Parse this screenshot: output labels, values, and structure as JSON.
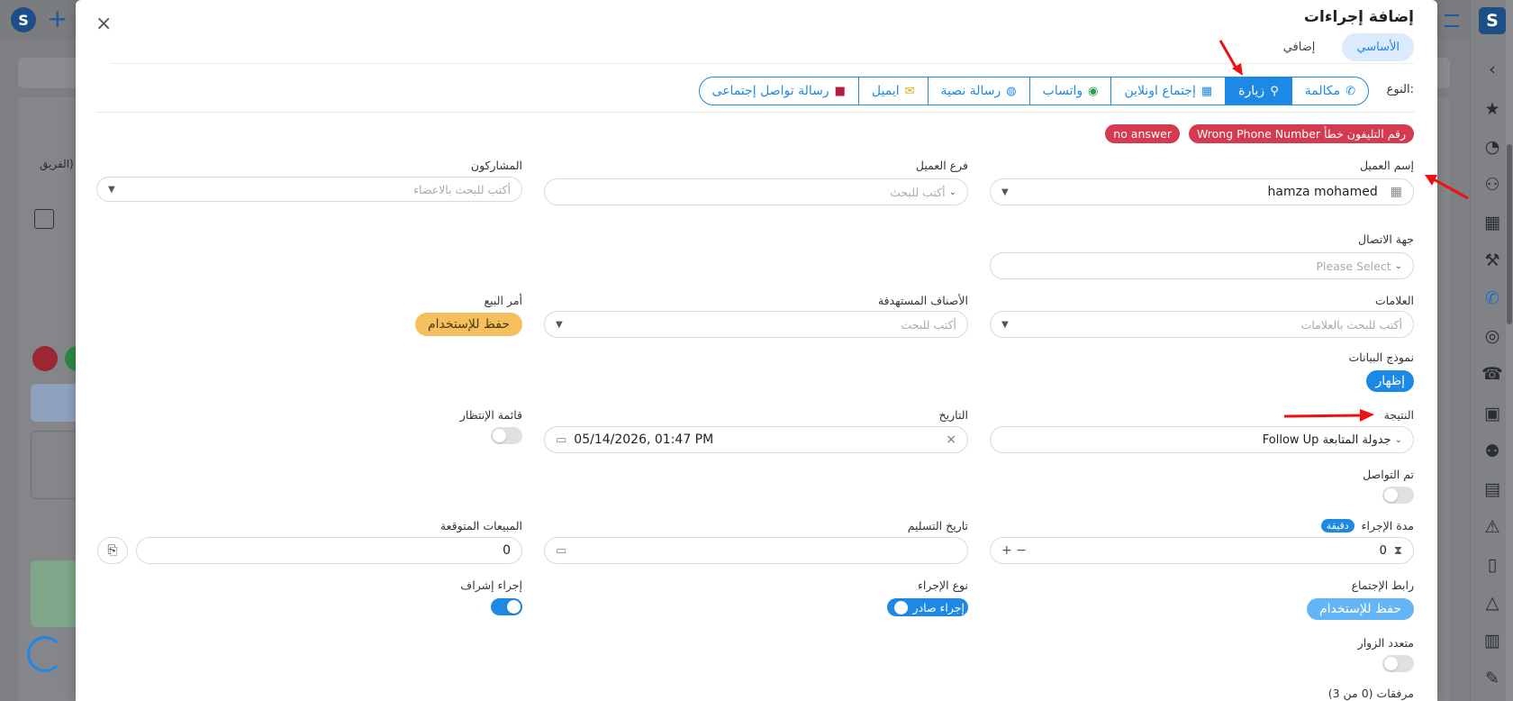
{
  "background": {
    "search_placeholder": "",
    "filter_label": "الفريق)"
  },
  "modal": {
    "title": "إضافة إجراءات",
    "close_icon": "×",
    "tabs": [
      {
        "label": "الأساسي"
      },
      {
        "label": "إضافي"
      }
    ],
    "type_label": "النوع:",
    "types": [
      {
        "label": "مكالمة",
        "icon": "call-icon"
      },
      {
        "label": "زيارة",
        "icon": "map-pin-icon",
        "active": true
      },
      {
        "label": "إجتماع اونلاين",
        "icon": "presentation-icon"
      },
      {
        "label": "واتساب",
        "icon": "whatsapp-icon"
      },
      {
        "label": "رسالة نصية",
        "icon": "sms-icon"
      },
      {
        "label": "ايميل",
        "icon": "email-icon"
      },
      {
        "label": "رسالة تواصل إجتماعى",
        "icon": "social-icon"
      }
    ],
    "tags": [
      "Wrong Phone Number رقم التليفون خطأ",
      "no answer"
    ],
    "fields": {
      "client_name": {
        "label": "إسم العميل",
        "value": "hamza mohamed"
      },
      "client_branch": {
        "label": "فرع العميل",
        "placeholder": "أكتب للبحث"
      },
      "participants": {
        "label": "المشاركون",
        "placeholder": "أكتب للبحث بالاعضاء"
      },
      "contact": {
        "label": "جهة الاتصال",
        "placeholder": "Please Select"
      },
      "marks": {
        "label": "العلامات",
        "placeholder": "أكتب للبحث بالعلامات"
      },
      "target_classes": {
        "label": "الأصناف المستهدفة",
        "placeholder": "أكتب للبحث"
      },
      "sales_order": {
        "label": "أمر البيع",
        "button": "حفظ للإستخدام"
      },
      "data_form": {
        "label": "نموذج البيانات",
        "button": "إظهار"
      },
      "result": {
        "label": "النتيجة",
        "value": "Follow Up جدولة المتابعة"
      },
      "date": {
        "label": "التاريخ",
        "value": "05/14/2026, 01:47 PM"
      },
      "waitlist": {
        "label": "قائمة الإنتظار"
      },
      "contacted": {
        "label": "تم التواصل"
      },
      "duration": {
        "label": "مدة الإجراء",
        "badge": "دقيقة",
        "value": "0"
      },
      "delivery_date": {
        "label": "تاريخ التسليم"
      },
      "expected_sales": {
        "label": "المبيعات المتوقعة",
        "value": "0"
      },
      "meeting_link": {
        "label": "رابط الإجتماع",
        "button": "حفظ للإستخدام"
      },
      "action_type": {
        "label": "نوع الإجراء",
        "value": "إجراء صادر"
      },
      "supervision": {
        "label": "إجراء إشراف"
      },
      "multi_visitors": {
        "label": "متعدد الزوار"
      },
      "attachments": {
        "label": "مرفقات (0 من 3)"
      }
    }
  }
}
